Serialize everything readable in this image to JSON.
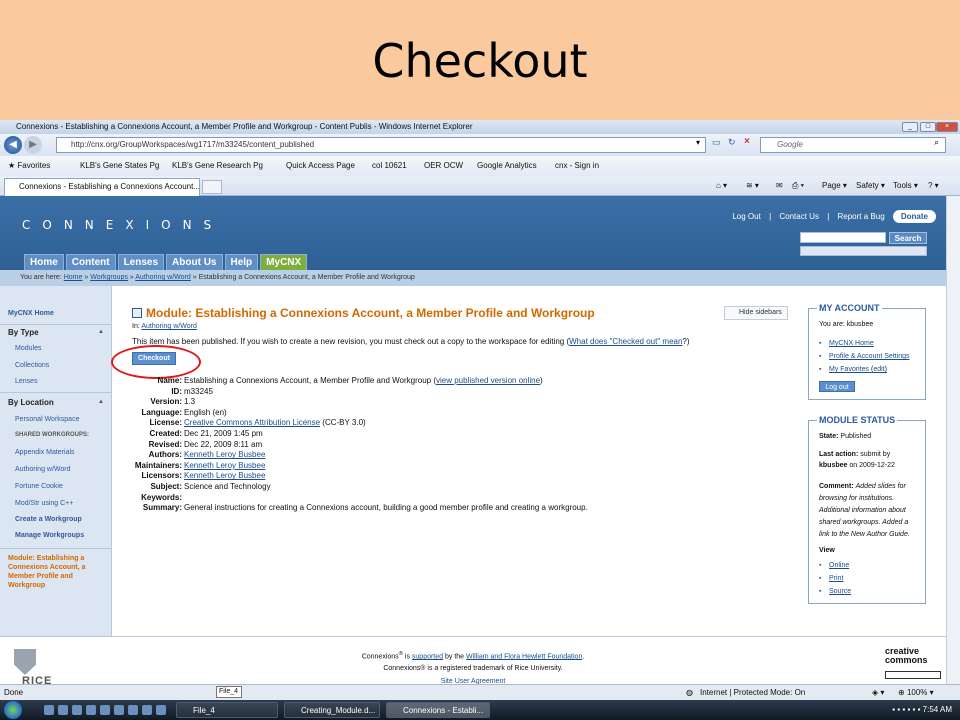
{
  "slide": {
    "title": "Checkout"
  },
  "browser": {
    "title": "Connexions - Establishing a Connexions Account, a Member Profile and Workgroup - Content Publis - Windows Internet Explorer",
    "url": "http://cnx.org/GroupWorkspaces/wg1717/m33245/content_published",
    "search_placeholder": "Google",
    "favorites": [
      "Favorites",
      "KLB's Gene States Pg",
      "KLB's Gene Research Pg",
      "Quick Access Page",
      "col 10621",
      "OER OCW",
      "Google Analytics",
      "cnx - Sign in"
    ],
    "tab_label": "Connexions - Establishing a Connexions Account...",
    "commands": {
      "page": "Page",
      "safety": "Safety",
      "tools": "Tools"
    }
  },
  "site": {
    "logo": "CONNEXIONS",
    "top_links": [
      "Log Out",
      "Contact Us",
      "Report a Bug"
    ],
    "donate": "Donate",
    "search_button": "Search",
    "nav_tabs": [
      "Home",
      "Content",
      "Lenses",
      "About Us",
      "Help",
      "MyCNX"
    ],
    "active_tab": "MyCNX",
    "breadcrumb_prefix": "You are here:",
    "breadcrumb": [
      "Home",
      "Workgroups",
      "Authoring w/Word",
      "Establishing a Connexions Account, a Member Profile and Workgroup"
    ],
    "breadcrumb_sep": "»"
  },
  "leftnav": {
    "mycnx_home": "MyCNX Home",
    "by_type": "By Type",
    "types": [
      "Modules",
      "Collections",
      "Lenses"
    ],
    "by_location": "By Location",
    "personal_workspace": "Personal Workspace",
    "shared_heading": "SHARED WORKGROUPS:",
    "workgroups": [
      "Appendix Materials",
      "Authoring w/Word",
      "Fortune Cookie",
      "Mod/Str using C++"
    ],
    "create_workgroup": "Create a Workgroup",
    "manage_workgroups": "Manage Workgroups",
    "current_module": "Module: Establishing a Connexions Account, a Member Profile and Workgroup"
  },
  "module": {
    "title": "Module: Establishing a Connexions Account, a Member Profile and Workgroup",
    "hide_sidebars": "Hide sidebars",
    "in_prefix": "In:",
    "in_link": "Authoring w/Word",
    "published_msg": "This item has been published. If you wish to create a new revision, you must check out a copy to the workspace for editing (",
    "published_link": "What does \"Checked out\" mean",
    "published_end": "?)",
    "checkout_button": "Checkout",
    "fields": [
      {
        "label": "Name:",
        "value": "Establishing a Connexions Account, a Member Profile and Workgroup (",
        "link": "view published version online",
        "after": ")"
      },
      {
        "label": "ID:",
        "value": "m33245"
      },
      {
        "label": "Version:",
        "value": "1.3"
      },
      {
        "label": "Language:",
        "value": "English (en)"
      },
      {
        "label": "License:",
        "value": "",
        "link": "Creative Commons Attribution License",
        "after": " (CC-BY 3.0)"
      },
      {
        "label": "Created:",
        "value": "Dec 21, 2009 1:45 pm"
      },
      {
        "label": "Revised:",
        "value": "Dec 22, 2009 8:11 am"
      },
      {
        "label": "Authors:",
        "value": "",
        "link": "Kenneth Leroy Busbee"
      },
      {
        "label": "Maintainers:",
        "value": "",
        "link": "Kenneth Leroy Busbee"
      },
      {
        "label": "Licensors:",
        "value": "",
        "link": "Kenneth Leroy Busbee"
      },
      {
        "label": "Subject:",
        "value": "Science and Technology"
      },
      {
        "label": "Keywords:",
        "value": ""
      },
      {
        "label": "Summary:",
        "value": "General instructions for creating a Connexions account, building a good member profile and creating a workgroup."
      }
    ]
  },
  "my_account": {
    "title": "MY ACCOUNT",
    "you_are": "You are: kbusbee",
    "links": [
      "MyCNX Home",
      "Profile & Account Settings",
      "My Favorites"
    ],
    "edit": "edit",
    "logout": "Log out"
  },
  "module_status": {
    "title": "MODULE STATUS",
    "state_label": "State:",
    "state": "Published",
    "last_action_label": "Last action:",
    "last_action": "submit by",
    "last_action_user": "kbusbee",
    "last_action_date": "on 2009-12-22",
    "comment_label": "Comment:",
    "comment": "Added slides for browsing for institutions. Additional information about shared workgroups. Added a link to the New Author Guide.",
    "view_label": "View",
    "view_links": [
      "Online",
      "Print",
      "Source"
    ]
  },
  "footer": {
    "line1_pre": "Connexions",
    "line1_mid": " is ",
    "line1_link1": "supported",
    "line1_by": " by the ",
    "line1_link2": "William and Flora Hewlett Foundation",
    "line1_end": ".",
    "line2": "Connexions® is a registered trademark of Rice University.",
    "line3": "Site User Agreement",
    "rice": "RICE",
    "cc": "creative commons"
  },
  "statusbar": {
    "left": "Done",
    "tooltip": "File_4",
    "zone": "Internet | Protected Mode: On",
    "zoom": "100%"
  },
  "taskbar": {
    "tasks": [
      "File_4",
      "Creating_Module.d...",
      "Connexions - Establi..."
    ],
    "clock": "7:54 AM"
  }
}
